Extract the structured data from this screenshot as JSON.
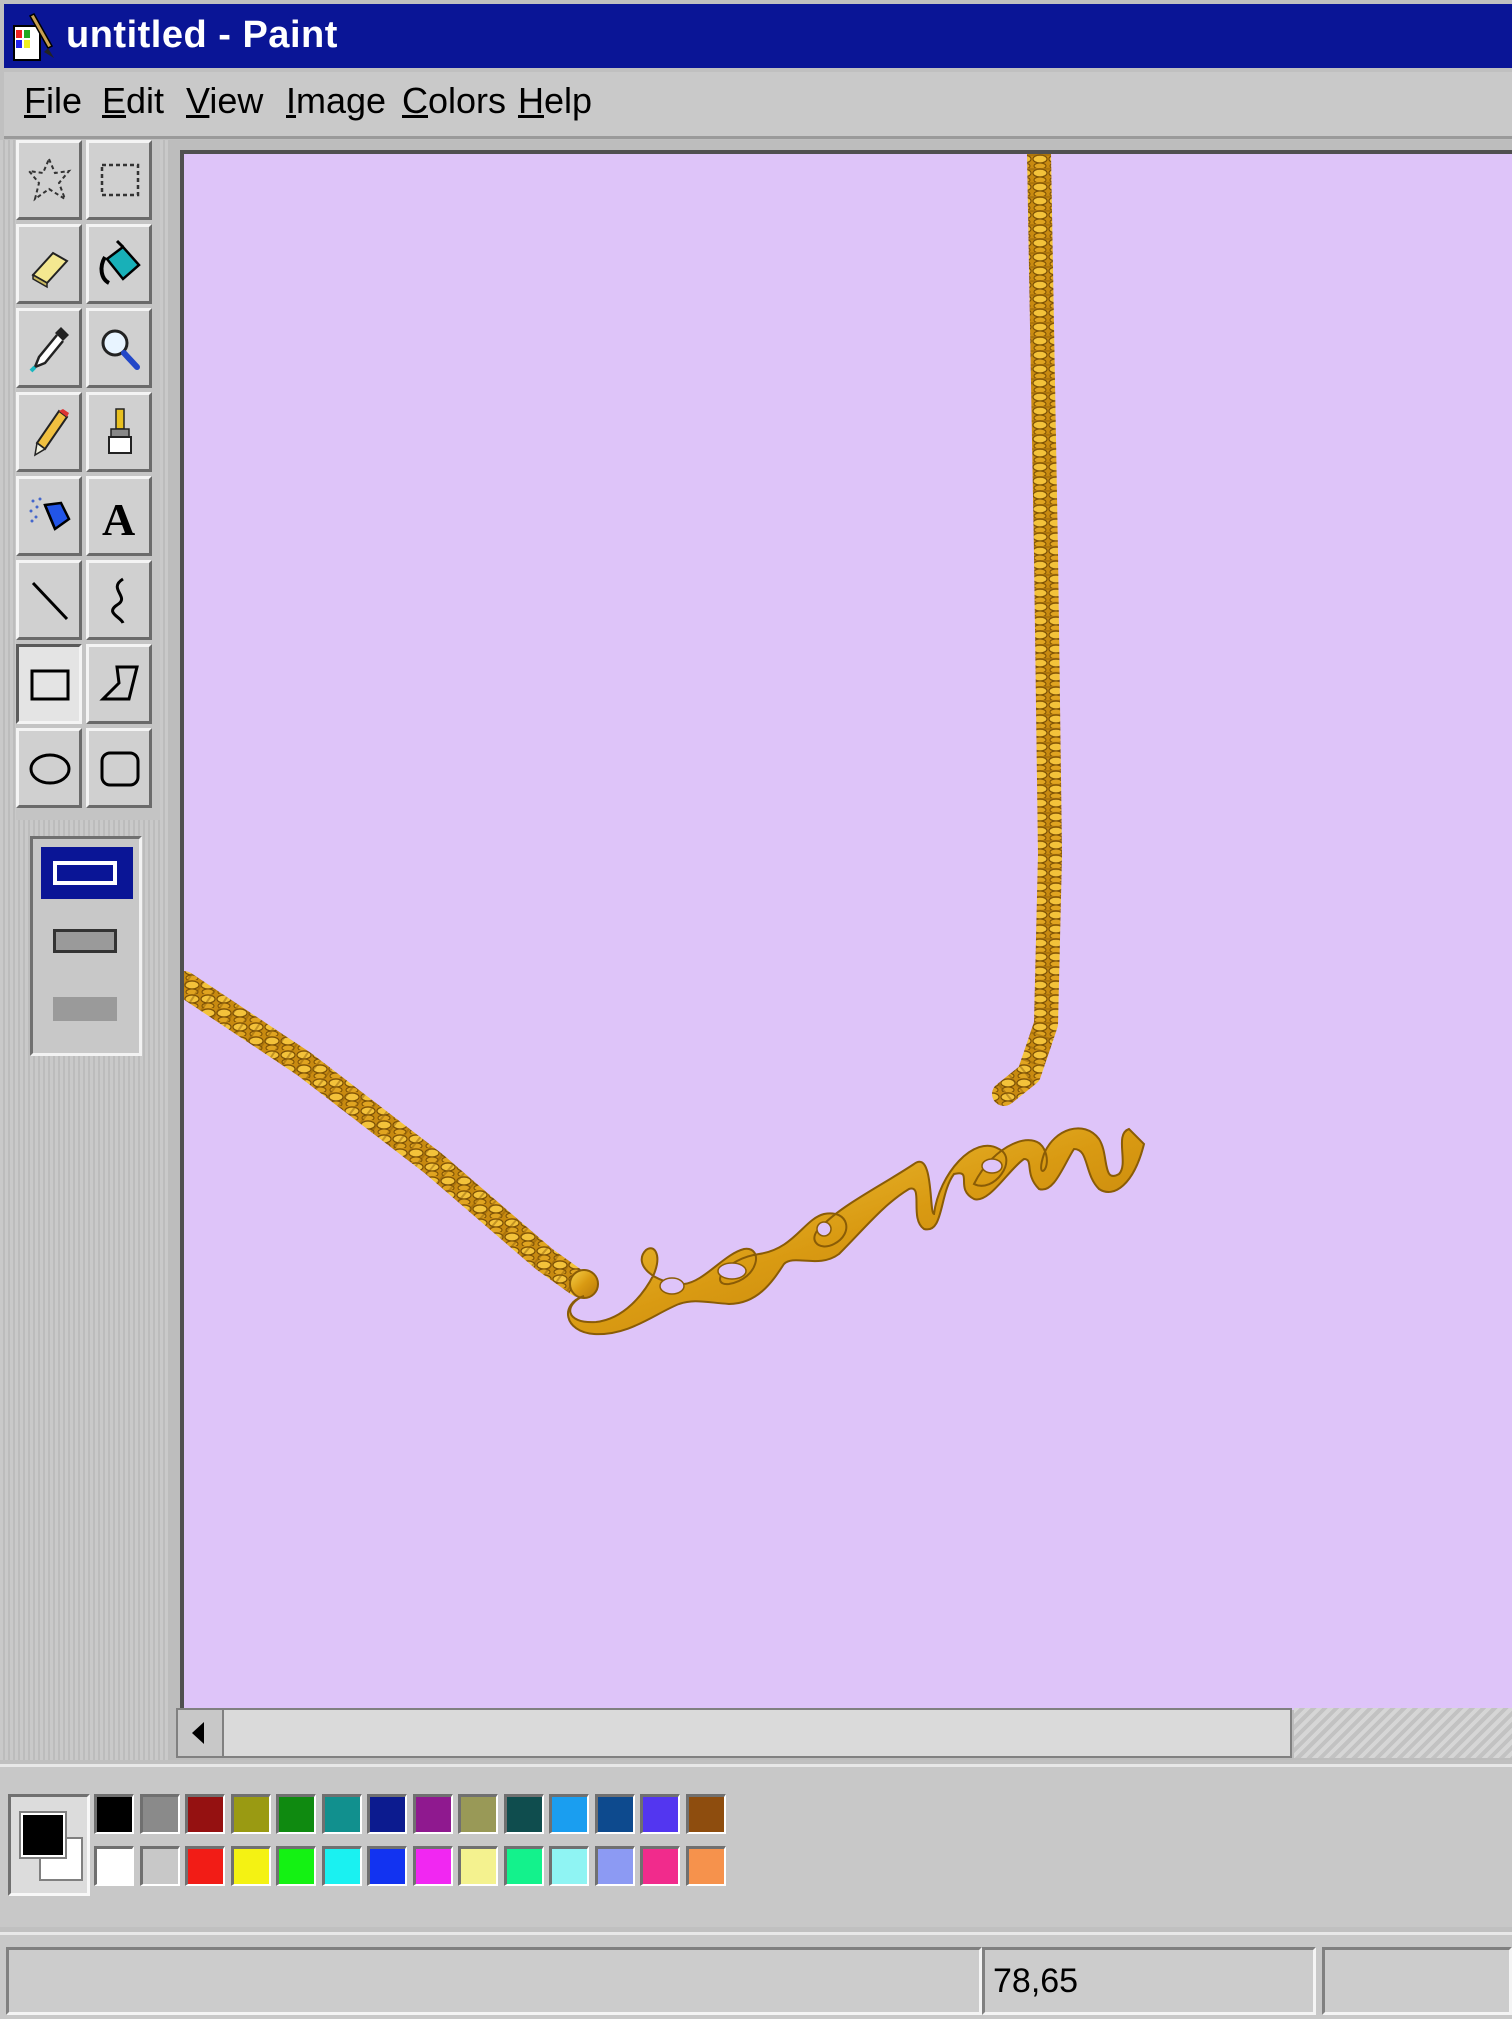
{
  "window": {
    "title": "untitled - Paint",
    "app_icon": "paint-app-icon"
  },
  "menu": {
    "items": [
      {
        "label": "File",
        "mnemonic": "F"
      },
      {
        "label": "Edit",
        "mnemonic": "E"
      },
      {
        "label": "View",
        "mnemonic": "V"
      },
      {
        "label": "Image",
        "mnemonic": "I"
      },
      {
        "label": "Colors",
        "mnemonic": "C"
      },
      {
        "label": "Help",
        "mnemonic": "H"
      }
    ]
  },
  "tools": [
    {
      "name": "free-form-select",
      "icon": "free-form-select-icon",
      "selected": false
    },
    {
      "name": "rectangle-select",
      "icon": "rectangle-select-icon",
      "selected": false
    },
    {
      "name": "eraser",
      "icon": "eraser-icon",
      "selected": false
    },
    {
      "name": "fill",
      "icon": "fill-bucket-icon",
      "selected": false
    },
    {
      "name": "pick-color",
      "icon": "eyedropper-icon",
      "selected": false
    },
    {
      "name": "magnifier",
      "icon": "magnifier-icon",
      "selected": false
    },
    {
      "name": "pencil",
      "icon": "pencil-icon",
      "selected": false
    },
    {
      "name": "brush",
      "icon": "brush-icon",
      "selected": false
    },
    {
      "name": "airbrush",
      "icon": "airbrush-icon",
      "selected": false
    },
    {
      "name": "text",
      "icon": "text-icon",
      "selected": false,
      "glyph": "A"
    },
    {
      "name": "line",
      "icon": "line-icon",
      "selected": false
    },
    {
      "name": "curve",
      "icon": "curve-icon",
      "selected": false
    },
    {
      "name": "rectangle",
      "icon": "rectangle-icon",
      "selected": true
    },
    {
      "name": "polygon",
      "icon": "polygon-icon",
      "selected": false
    },
    {
      "name": "ellipse",
      "icon": "ellipse-icon",
      "selected": false
    },
    {
      "name": "rounded-rectangle",
      "icon": "rounded-rectangle-icon",
      "selected": false
    }
  ],
  "fill_options": [
    {
      "name": "outline",
      "selected": true
    },
    {
      "name": "outline-fill",
      "selected": false
    },
    {
      "name": "fill-only",
      "selected": false
    }
  ],
  "canvas": {
    "background": "#dec4f9",
    "content": "gold curb chain necklace with script name pendant"
  },
  "colors": {
    "foreground": "#000000",
    "background": "#ffffff",
    "palette_top": [
      "#000000",
      "#8a8a8a",
      "#951111",
      "#9a9a12",
      "#0f8a10",
      "#11908e",
      "#0c1b8f",
      "#8f198f",
      "#999957",
      "#0f4d4e",
      "#1a9ef0",
      "#0d4a8e",
      "#5336f0",
      "#8e4d0e"
    ],
    "palette_bottom": [
      "#ffffff",
      "#c8c8c8",
      "#f21c16",
      "#f4f213",
      "#14f213",
      "#1af1f1",
      "#1233f1",
      "#f127f2",
      "#f4f28f",
      "#13f28c",
      "#8ff4f3",
      "#8c9af3",
      "#f12b8c",
      "#f6924c"
    ]
  },
  "status": {
    "coordinates": "78,65"
  }
}
